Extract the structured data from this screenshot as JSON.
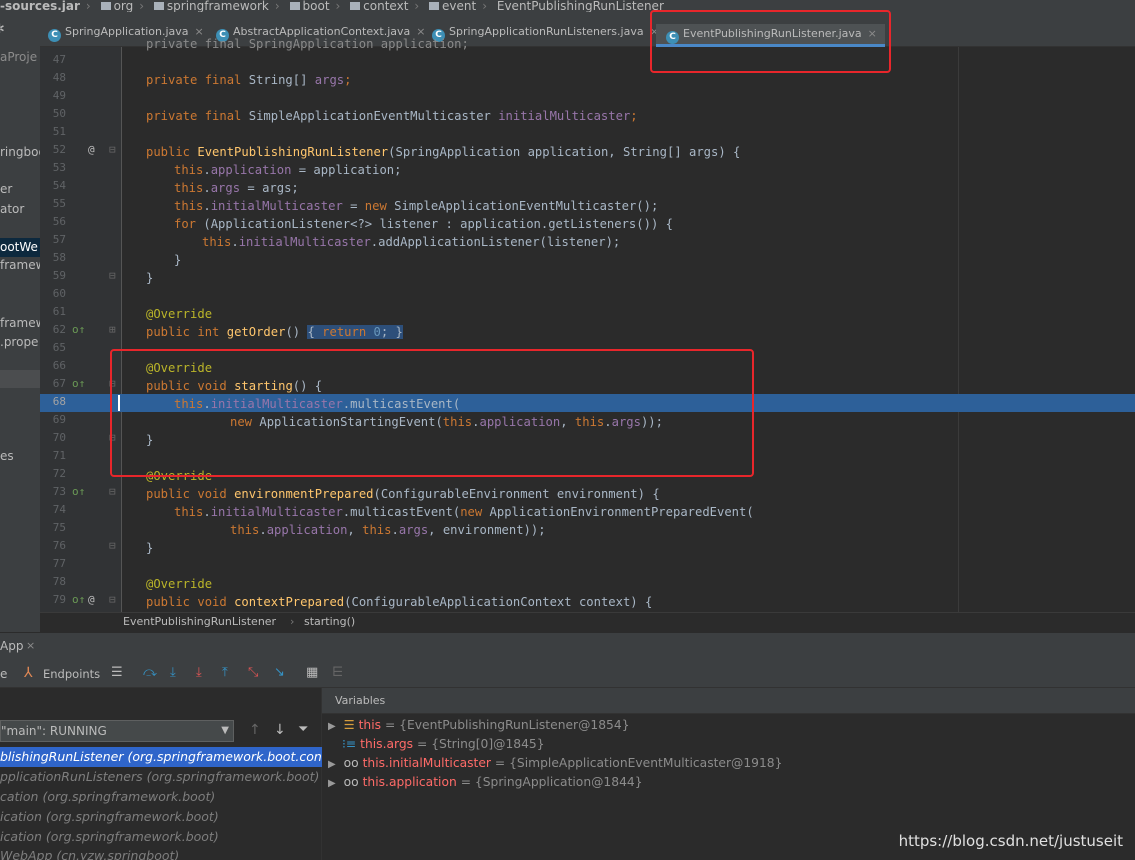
{
  "navbar": {
    "crumbs": [
      "-sources.jar",
      "org",
      "springframework",
      "boot",
      "context",
      "event",
      "EventPublishingRunListener"
    ]
  },
  "tabs": [
    {
      "label": "SpringApplication.java"
    },
    {
      "label": "AbstractApplicationContext.java"
    },
    {
      "label": "SpringApplicationRunListeners.java"
    },
    {
      "label": "EventPublishingRunListener.java",
      "active": true
    }
  ],
  "project_strip": [
    "aProje",
    "ringboo",
    "er",
    "ator",
    "ootWe",
    "framew",
    "framew",
    ".prope",
    "es"
  ],
  "line_numbers": [
    "47",
    "48",
    "49",
    "50",
    "51",
    "52",
    "53",
    "54",
    "55",
    "56",
    "57",
    "58",
    "59",
    "60",
    "61",
    "62",
    "65",
    "66",
    "67",
    "68",
    "69",
    "70",
    "71",
    "72",
    "73",
    "74",
    "75",
    "76",
    "77",
    "78",
    "79"
  ],
  "code": {
    "l47": "private final SpringApplication application;",
    "l48a": "private final",
    "l48b": " String[] ",
    "l48c": "args",
    "l50a": "private final",
    "l50b": " SimpleApplicationEventMulticaster ",
    "l50c": "initialMulticaster",
    "l52a": "public",
    "l52b": "EventPublishingRunListener",
    "l52c": "(SpringApplication application, String[] args) {",
    "this": "this",
    "application": "application",
    "args": "args",
    "initialMulticaster": "initialMulticaster",
    "l53c": " = application;",
    "l54c": " = args;",
    "new": "new",
    "l55c": " = ",
    "l55d": " SimpleApplicationEventMulticaster();",
    "for": "for",
    "l56b": " (ApplicationListener<?> listener : application.getListeners()) {",
    "l57c": ".addApplicationListener(listener);",
    "rbrace": "}",
    "override": "@Override",
    "public": "public",
    "int": "int",
    "void": "void",
    "return": "return",
    "l62c": "getOrder",
    "l62d": "() ",
    "l62e": "{ ",
    "l62f": "0",
    "l62g": "; }",
    "l67c": "starting",
    "l67d": "() {",
    "l68c": ".multicastEvent(",
    "l69b": " ApplicationStartingEvent(",
    "l69c": ", ",
    "l69d": "));",
    "l73c": "environmentPrepared",
    "l73d": "(ConfigurableEnvironment environment) {",
    "l74c": ".multicastEvent(",
    "l74d": " ApplicationEnvironmentPreparedEvent(",
    "l75a": ", ",
    "l75b": ", environment));",
    "l79c": "contextPrepared",
    "l79d": "(ConfigurableApplicationContext context) {",
    "semicolon": ";"
  },
  "breadcrumb": {
    "cls": "EventPublishingRunListener",
    "method": "starting()"
  },
  "debug": {
    "tab_label": "App",
    "endpoints": "Endpoints",
    "thread": "\"main\": RUNNING",
    "frames": [
      "blishingRunListener (org.springframework.boot.conte",
      "pplicationRunListeners (org.springframework.boot)",
      "cation (org.springframework.boot)",
      "ication (org.springframework.boot)",
      "ication (org.springframework.boot)",
      "WebApp (cn.yzw.springboot)"
    ],
    "variables_title": "Variables",
    "variables": [
      {
        "name": "this",
        "value": "{EventPublishingRunListener@1854}"
      },
      {
        "name": "this.args",
        "value": "{String[0]@1845}"
      },
      {
        "name": "this.initialMulticaster",
        "value": "{SimpleApplicationEventMulticaster@1918}"
      },
      {
        "name": "this.application",
        "value": "{SpringApplication@1844}"
      }
    ],
    "equals": " = "
  },
  "watermark": "https://blog.csdn.net/justuseit"
}
